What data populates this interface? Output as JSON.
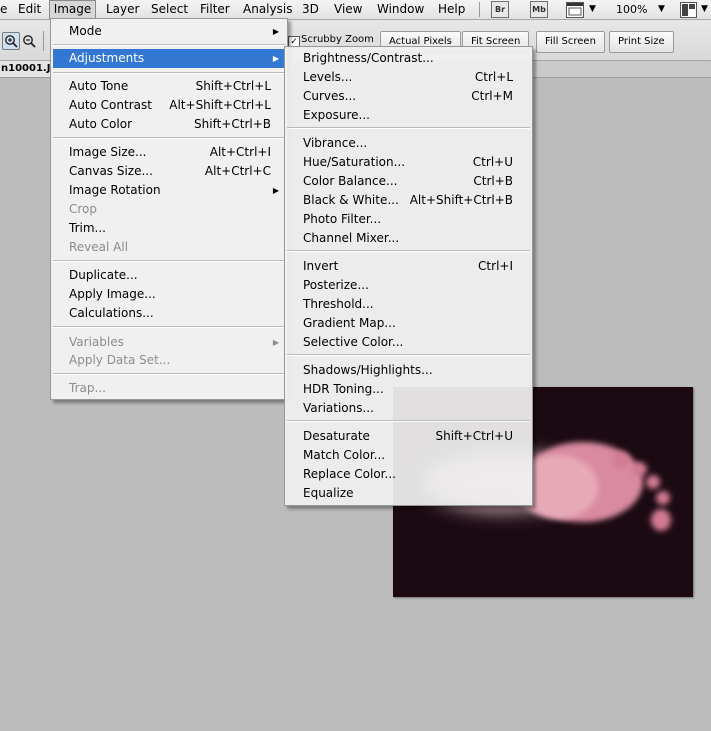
{
  "menubar": {
    "items": [
      "e",
      "Edit",
      "Image",
      "Layer",
      "Select",
      "Filter",
      "Analysis",
      "3D",
      "View",
      "Window",
      "Help"
    ],
    "br_label": "Br",
    "mb_label": "Mb",
    "zoom": "100%"
  },
  "options": {
    "scrubby_label": "Scrubby Zoom",
    "buttons": [
      "Actual Pixels",
      "Fit Screen",
      "Fill Screen",
      "Print Size"
    ]
  },
  "doc_tab": "n10001.JP",
  "image_menu": {
    "items": [
      {
        "label": "Mode",
        "shortcut": "",
        "submenu": true,
        "disabled": false
      },
      {
        "label": "Adjustments",
        "shortcut": "",
        "submenu": true,
        "disabled": false,
        "highlight": true
      },
      {
        "label": "Auto Tone",
        "shortcut": "Shift+Ctrl+L",
        "disabled": false
      },
      {
        "label": "Auto Contrast",
        "shortcut": "Alt+Shift+Ctrl+L",
        "disabled": false
      },
      {
        "label": "Auto Color",
        "shortcut": "Shift+Ctrl+B",
        "disabled": false
      },
      {
        "label": "Image Size...",
        "shortcut": "Alt+Ctrl+I",
        "disabled": false
      },
      {
        "label": "Canvas Size...",
        "shortcut": "Alt+Ctrl+C",
        "disabled": false
      },
      {
        "label": "Image Rotation",
        "shortcut": "",
        "submenu": true,
        "disabled": false
      },
      {
        "label": "Crop",
        "shortcut": "",
        "disabled": true
      },
      {
        "label": "Trim...",
        "shortcut": "",
        "disabled": false
      },
      {
        "label": "Reveal All",
        "shortcut": "",
        "disabled": true
      },
      {
        "label": "Duplicate...",
        "shortcut": "",
        "disabled": false
      },
      {
        "label": "Apply Image...",
        "shortcut": "",
        "disabled": false
      },
      {
        "label": "Calculations...",
        "shortcut": "",
        "disabled": false
      },
      {
        "label": "Variables",
        "shortcut": "",
        "submenu": true,
        "disabled": true
      },
      {
        "label": "Apply Data Set...",
        "shortcut": "",
        "disabled": true
      },
      {
        "label": "Trap...",
        "shortcut": "",
        "disabled": true
      }
    ]
  },
  "adjustments_menu": {
    "items": [
      {
        "label": "Brightness/Contrast...",
        "shortcut": ""
      },
      {
        "label": "Levels...",
        "shortcut": "Ctrl+L"
      },
      {
        "label": "Curves...",
        "shortcut": "Ctrl+M"
      },
      {
        "label": "Exposure...",
        "shortcut": ""
      },
      {
        "label": "Vibrance...",
        "shortcut": ""
      },
      {
        "label": "Hue/Saturation...",
        "shortcut": "Ctrl+U"
      },
      {
        "label": "Color Balance...",
        "shortcut": "Ctrl+B"
      },
      {
        "label": "Black & White...",
        "shortcut": "Alt+Shift+Ctrl+B"
      },
      {
        "label": "Photo Filter...",
        "shortcut": ""
      },
      {
        "label": "Channel Mixer...",
        "shortcut": ""
      },
      {
        "label": "Invert",
        "shortcut": "Ctrl+I"
      },
      {
        "label": "Posterize...",
        "shortcut": ""
      },
      {
        "label": "Threshold...",
        "shortcut": ""
      },
      {
        "label": "Gradient Map...",
        "shortcut": ""
      },
      {
        "label": "Selective Color...",
        "shortcut": ""
      },
      {
        "label": "Shadows/Highlights...",
        "shortcut": ""
      },
      {
        "label": "HDR Toning...",
        "shortcut": ""
      },
      {
        "label": "Variations...",
        "shortcut": ""
      },
      {
        "label": "Desaturate",
        "shortcut": "Shift+Ctrl+U"
      },
      {
        "label": "Match Color...",
        "shortcut": ""
      },
      {
        "label": "Replace Color...",
        "shortcut": ""
      },
      {
        "label": "Equalize",
        "shortcut": ""
      }
    ]
  },
  "colors": {
    "highlight": "#3278d2",
    "workspace": "#bcbcbc"
  }
}
